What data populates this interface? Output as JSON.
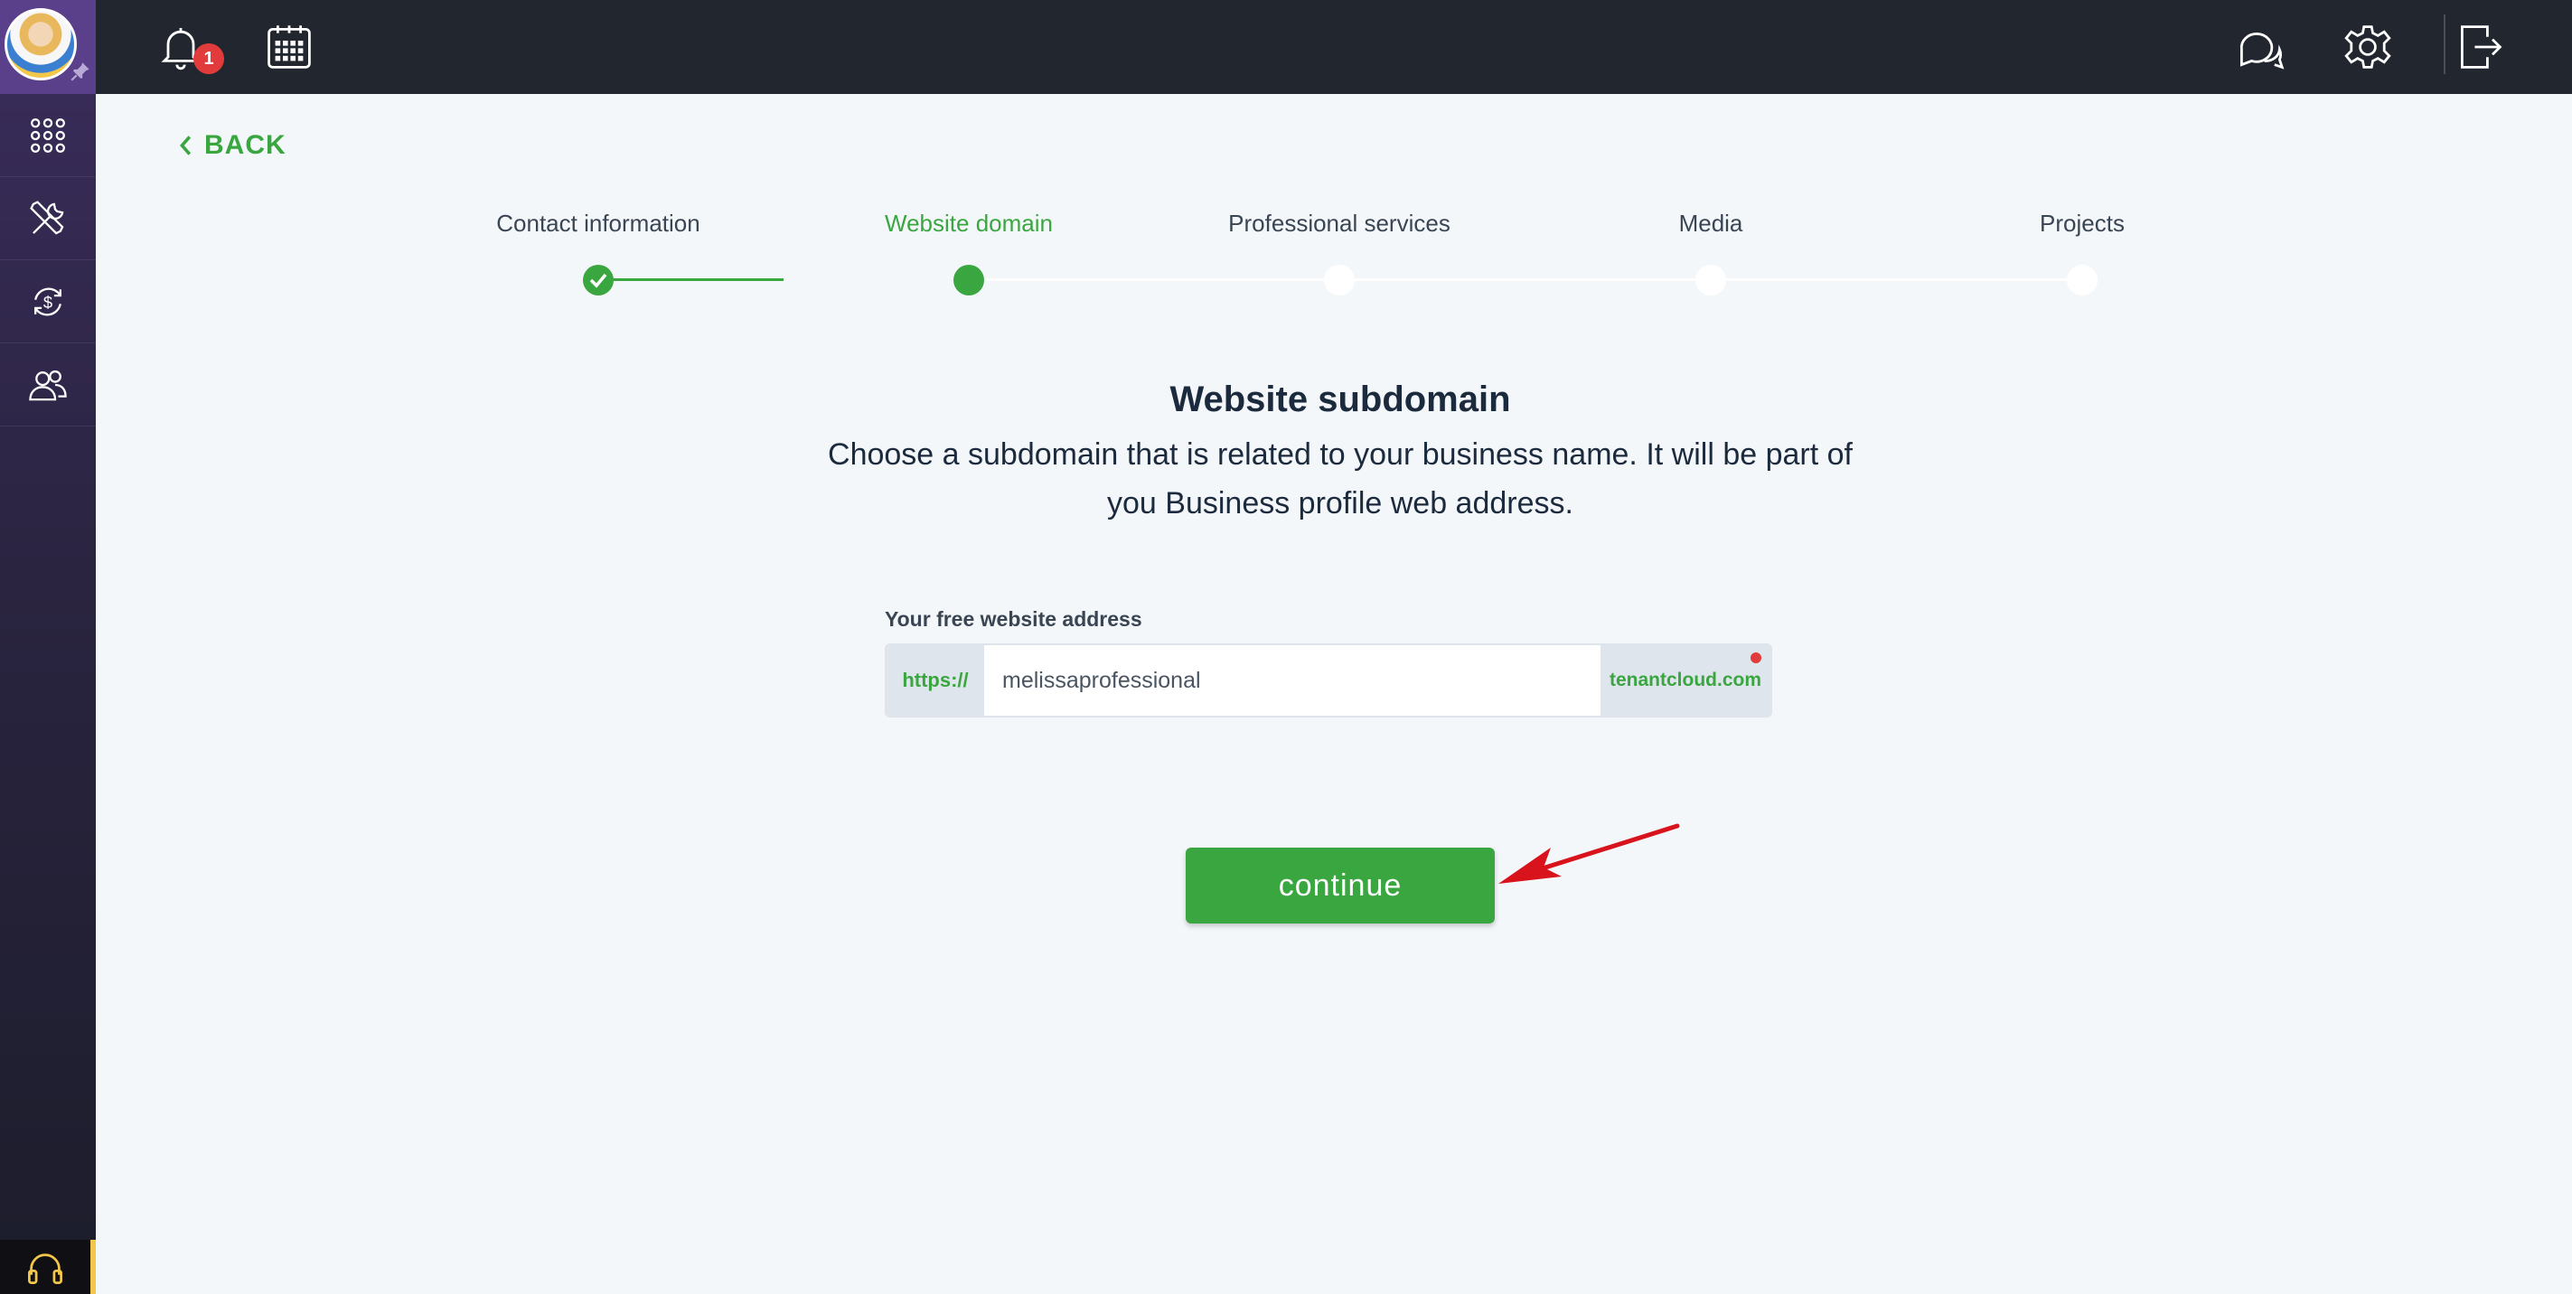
{
  "topbar": {
    "notification_count": "1"
  },
  "back_label": "BACK",
  "steps": [
    {
      "label": "Contact information",
      "state": "done"
    },
    {
      "label": "Website domain",
      "state": "active"
    },
    {
      "label": "Professional services",
      "state": "pending"
    },
    {
      "label": "Media",
      "state": "pending"
    },
    {
      "label": "Projects",
      "state": "pending"
    }
  ],
  "main": {
    "heading": "Website subdomain",
    "subtext": "Choose a subdomain that is related to your business name. It will be part of you Business profile web address.",
    "field_label": "Your free website address",
    "prefix": "https://",
    "subdomain_value": "melissaprofessional",
    "suffix": "tenantcloud.com",
    "continue_label": "continue"
  },
  "colors": {
    "accent": "#3aa640",
    "topbar": "#22262f",
    "badge": "#e23b3b",
    "annotation_arrow": "#d9131b"
  }
}
